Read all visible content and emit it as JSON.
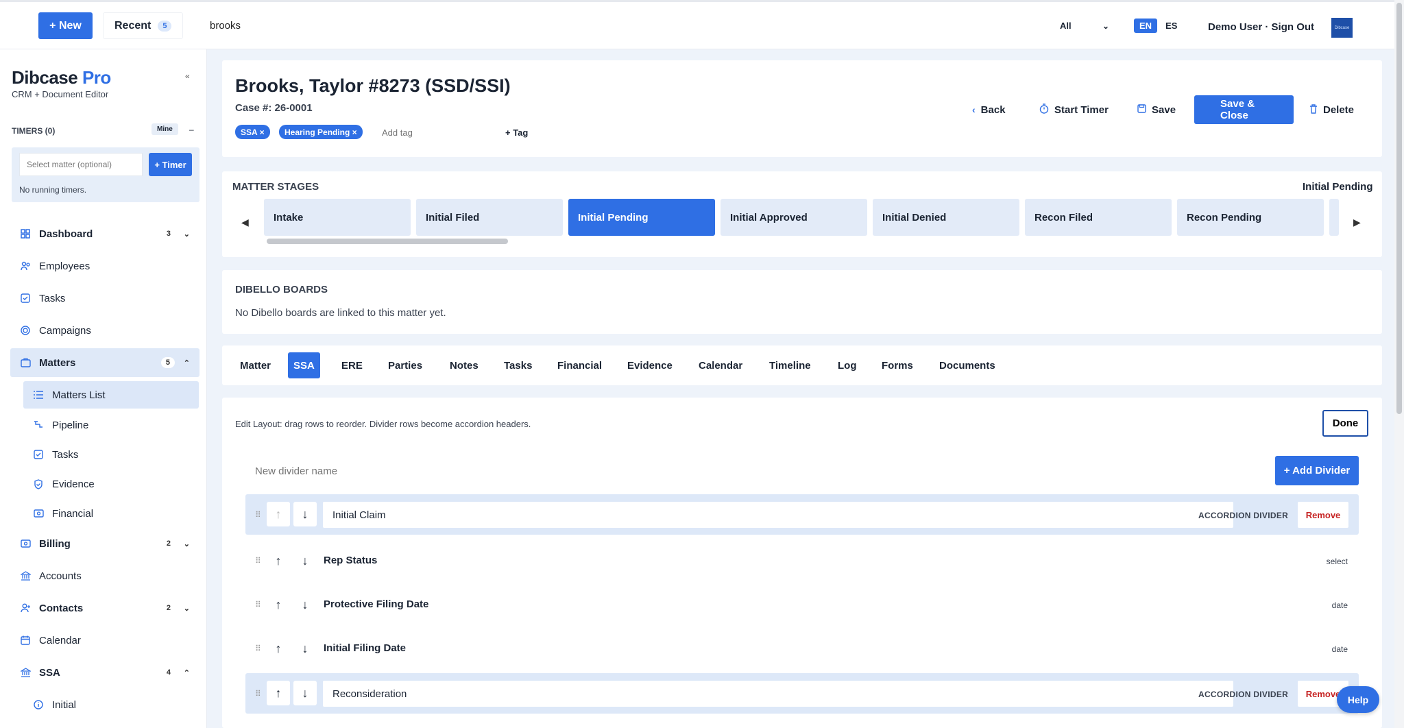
{
  "topbar": {
    "new_label": "+ New",
    "recent_label": "Recent",
    "recent_count": "5",
    "search_value": "brooks",
    "scope": "All",
    "lang_en": "EN",
    "lang_es": "ES",
    "user": "Demo User · Sign Out",
    "logo_text": "Dibcase"
  },
  "sidebar": {
    "brand": "Dibcase",
    "brand_pro": "Pro",
    "subtitle": "CRM + Document Editor",
    "collapse": "«",
    "timers_heading": "TIMERS (0)",
    "mine": "Mine",
    "minus": "–",
    "select_matter_placeholder": "Select matter (optional)",
    "add_timer": "+ Timer",
    "no_timers": "No running timers.",
    "items": [
      {
        "label": "Dashboard",
        "count": "3",
        "chevron": "⌄"
      },
      {
        "label": "Employees"
      },
      {
        "label": "Tasks"
      },
      {
        "label": "Campaigns"
      },
      {
        "label": "Matters",
        "count": "5",
        "chevron": "⌃"
      },
      {
        "label": "Matters List"
      },
      {
        "label": "Pipeline"
      },
      {
        "label": "Tasks"
      },
      {
        "label": "Evidence"
      },
      {
        "label": "Financial"
      },
      {
        "label": "Billing",
        "count": "2",
        "chevron": "⌄"
      },
      {
        "label": "Accounts"
      },
      {
        "label": "Contacts",
        "count": "2",
        "chevron": "⌄"
      },
      {
        "label": "Calendar"
      },
      {
        "label": "SSA",
        "count": "4",
        "chevron": "⌃"
      },
      {
        "label": "Initial"
      }
    ]
  },
  "header": {
    "title": "Brooks, Taylor #8273 (SSD/SSI)",
    "case_no": "Case #: 26-0001",
    "tags": [
      "SSA ×",
      "Hearing Pending ×"
    ],
    "add_tag_placeholder": "Add tag",
    "add_tag_btn": "+ Tag",
    "back": "Back",
    "start_timer": "Start Timer",
    "save": "Save",
    "save_close": "Save & Close",
    "delete": "Delete"
  },
  "stages": {
    "heading": "MATTER STAGES",
    "current": "Initial Pending",
    "items": [
      "Intake",
      "Initial Filed",
      "Initial Pending",
      "Initial Approved",
      "Initial Denied",
      "Recon Filed",
      "Recon Pending"
    ],
    "active_index": 2
  },
  "boards": {
    "heading": "DIBELLO BOARDS",
    "text": "No Dibello boards are linked to this matter yet."
  },
  "tabs": [
    "Matter",
    "SSA",
    "ERE",
    "Parties",
    "Notes",
    "Tasks",
    "Financial",
    "Evidence",
    "Calendar",
    "Timeline",
    "Log",
    "Forms",
    "Documents"
  ],
  "active_tab": "SSA",
  "layout_editor": {
    "hint": "Edit Layout: drag rows to reorder. Divider rows become accordion headers.",
    "done": "Done",
    "divider_placeholder": "New divider name",
    "add_divider": "+ Add Divider",
    "accordion_label": "ACCORDION DIVIDER",
    "remove": "Remove",
    "rows": [
      {
        "kind": "divider",
        "label": "Initial Claim"
      },
      {
        "kind": "field",
        "label": "Rep Status",
        "type": "select"
      },
      {
        "kind": "field",
        "label": "Protective Filing Date",
        "type": "date"
      },
      {
        "kind": "field",
        "label": "Initial Filing Date",
        "type": "date"
      },
      {
        "kind": "divider",
        "label": "Reconsideration"
      }
    ]
  },
  "help": "Help",
  "colors": {
    "accent": "#2f6fe4",
    "page_bg": "#eef3fa",
    "danger": "#c62323"
  }
}
